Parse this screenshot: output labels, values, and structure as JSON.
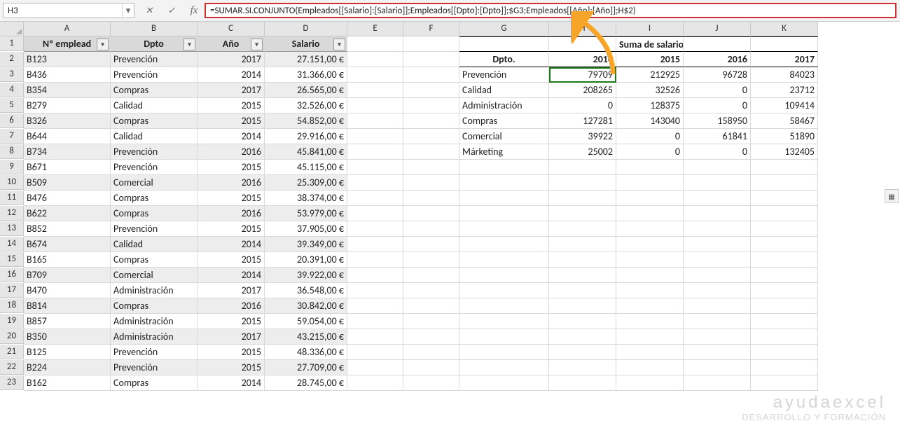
{
  "namebox": "H3",
  "formula": "=SUMAR.SI.CONJUNTO(Empleados[[Salario]:[Salario]];Empleados[[Dpto]:[Dpto]];$G3;Empleados[[Año]:[Año]];H$2)",
  "columns": [
    "A",
    "B",
    "C",
    "D",
    "E",
    "F",
    "G",
    "H",
    "I",
    "J",
    "K"
  ],
  "table1": {
    "headers": [
      "Nº emplead",
      "Dpto",
      "Año",
      "Salario"
    ],
    "rows": [
      [
        "B123",
        "Prevención",
        "2017",
        "27.151,00 €"
      ],
      [
        "B436",
        "Prevención",
        "2014",
        "31.366,00 €"
      ],
      [
        "B354",
        "Compras",
        "2017",
        "26.565,00 €"
      ],
      [
        "B279",
        "Calidad",
        "2015",
        "32.526,00 €"
      ],
      [
        "B326",
        "Compras",
        "2015",
        "54.852,00 €"
      ],
      [
        "B644",
        "Calidad",
        "2014",
        "29.916,00 €"
      ],
      [
        "B734",
        "Prevención",
        "2016",
        "45.841,00 €"
      ],
      [
        "B671",
        "Prevención",
        "2015",
        "45.115,00 €"
      ],
      [
        "B509",
        "Comercial",
        "2016",
        "25.309,00 €"
      ],
      [
        "B476",
        "Compras",
        "2015",
        "38.374,00 €"
      ],
      [
        "B622",
        "Compras",
        "2016",
        "53.979,00 €"
      ],
      [
        "B852",
        "Prevención",
        "2015",
        "37.905,00 €"
      ],
      [
        "B674",
        "Calidad",
        "2014",
        "39.349,00 €"
      ],
      [
        "B165",
        "Compras",
        "2015",
        "20.391,00 €"
      ],
      [
        "B709",
        "Comercial",
        "2014",
        "39.922,00 €"
      ],
      [
        "B470",
        "Administración",
        "2017",
        "36.548,00 €"
      ],
      [
        "B814",
        "Compras",
        "2016",
        "30.842,00 €"
      ],
      [
        "B857",
        "Administración",
        "2015",
        "59.054,00 €"
      ],
      [
        "B350",
        "Administración",
        "2017",
        "43.215,00 €"
      ],
      [
        "B125",
        "Prevención",
        "2015",
        "48.336,00 €"
      ],
      [
        "B224",
        "Prevención",
        "2015",
        "27.709,00 €"
      ],
      [
        "B162",
        "Compras",
        "2014",
        "28.745,00 €"
      ]
    ]
  },
  "pivot": {
    "title": "Suma de salarios anuales",
    "corner": "Dpto.",
    "years": [
      "2014",
      "2015",
      "2016",
      "2017"
    ],
    "rows": [
      {
        "dpto": "Prevención",
        "v": [
          "79709",
          "212925",
          "96728",
          "84023"
        ]
      },
      {
        "dpto": "Calidad",
        "v": [
          "208265",
          "32526",
          "0",
          "23712"
        ]
      },
      {
        "dpto": "Administración",
        "v": [
          "0",
          "128375",
          "0",
          "109414"
        ]
      },
      {
        "dpto": "Compras",
        "v": [
          "127281",
          "143040",
          "158950",
          "58467"
        ]
      },
      {
        "dpto": "Comercial",
        "v": [
          "39922",
          "0",
          "61841",
          "51890"
        ]
      },
      {
        "dpto": "Márketing",
        "v": [
          "25002",
          "0",
          "0",
          "132405"
        ]
      }
    ]
  },
  "watermark": {
    "big": "ayudaexcel",
    "small": "DESARROLLO Y FORMACIÓN"
  }
}
